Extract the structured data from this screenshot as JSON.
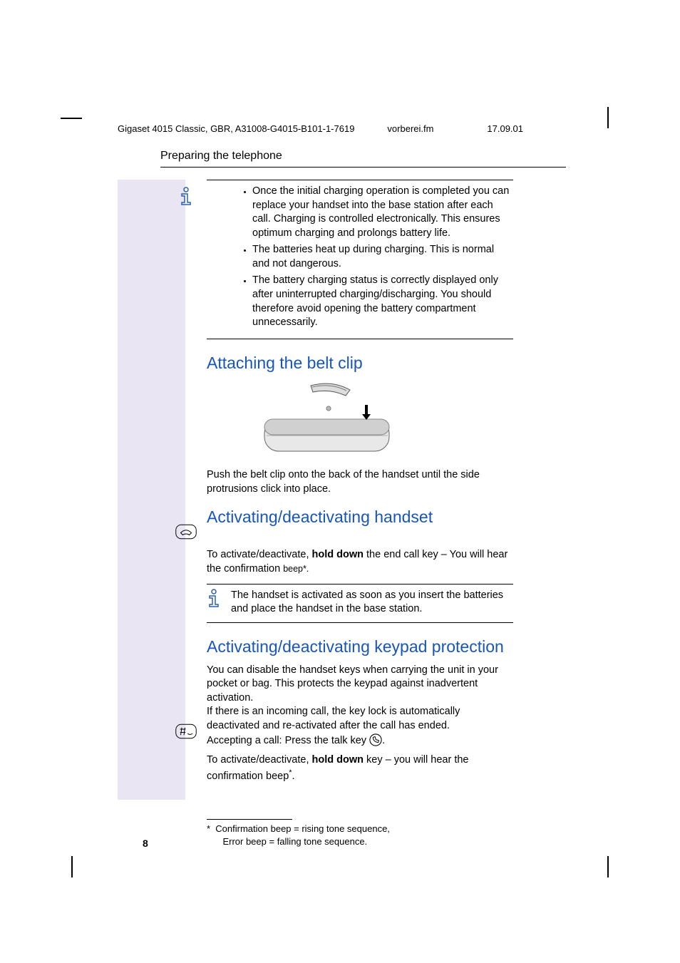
{
  "header": {
    "doc_id": "Gigaset 4015 Classic, GBR, A31008-G4015-B101-1-7619",
    "filename": "vorberei.fm",
    "date": "17.09.01"
  },
  "section_title": "Preparing the telephone",
  "note1": {
    "items": [
      "Once the initial charging operation is completed you can replace your handset into the base station after each call. Charging is controlled electronically. This ensures optimum charging and prolongs battery life.",
      "The batteries heat up during charging. This is normal and not dangerous.",
      "The battery charging status is correctly displayed only after uninterrupted charging/discharging. You should therefore avoid opening the battery compartment unnecessarily."
    ]
  },
  "belt_clip": {
    "heading": "Attaching  the belt clip",
    "text": "Push the belt clip onto the back of the handset until the side protrusions click into place."
  },
  "handset": {
    "heading": "Activating/deactivating handset",
    "text_a": "To activate/deactivate, ",
    "text_b": "hold down",
    "text_c": " the end call key  –  You will hear the confirmation ",
    "text_d": "beep",
    "text_e": "*."
  },
  "note2": {
    "text": "The handset is activated as soon as you insert the batteries and place the handset in the base station."
  },
  "keypad": {
    "heading": "Activating/deactivating keypad protection",
    "p1": "You can disable the handset keys when carrying the unit in your pocket or bag. This protects the keypad against inadvertent activation.",
    "p2": "If there is an incoming call, the key lock is automatically deactivated and re-activated after the call has ended.",
    "p3a": "Accepting a call: Press the talk key ",
    "p3b": ".",
    "t_a": "To activate/deactivate, ",
    "t_b": "hold down",
    "t_c": " key  –  you will hear the confirmation beep",
    "t_d": "*",
    "t_e": "."
  },
  "footnote": {
    "marker": "*",
    "l1": "Confirmation beep = rising tone sequence,",
    "l2": "Error beep = falling tone sequence."
  },
  "page_number": "8"
}
